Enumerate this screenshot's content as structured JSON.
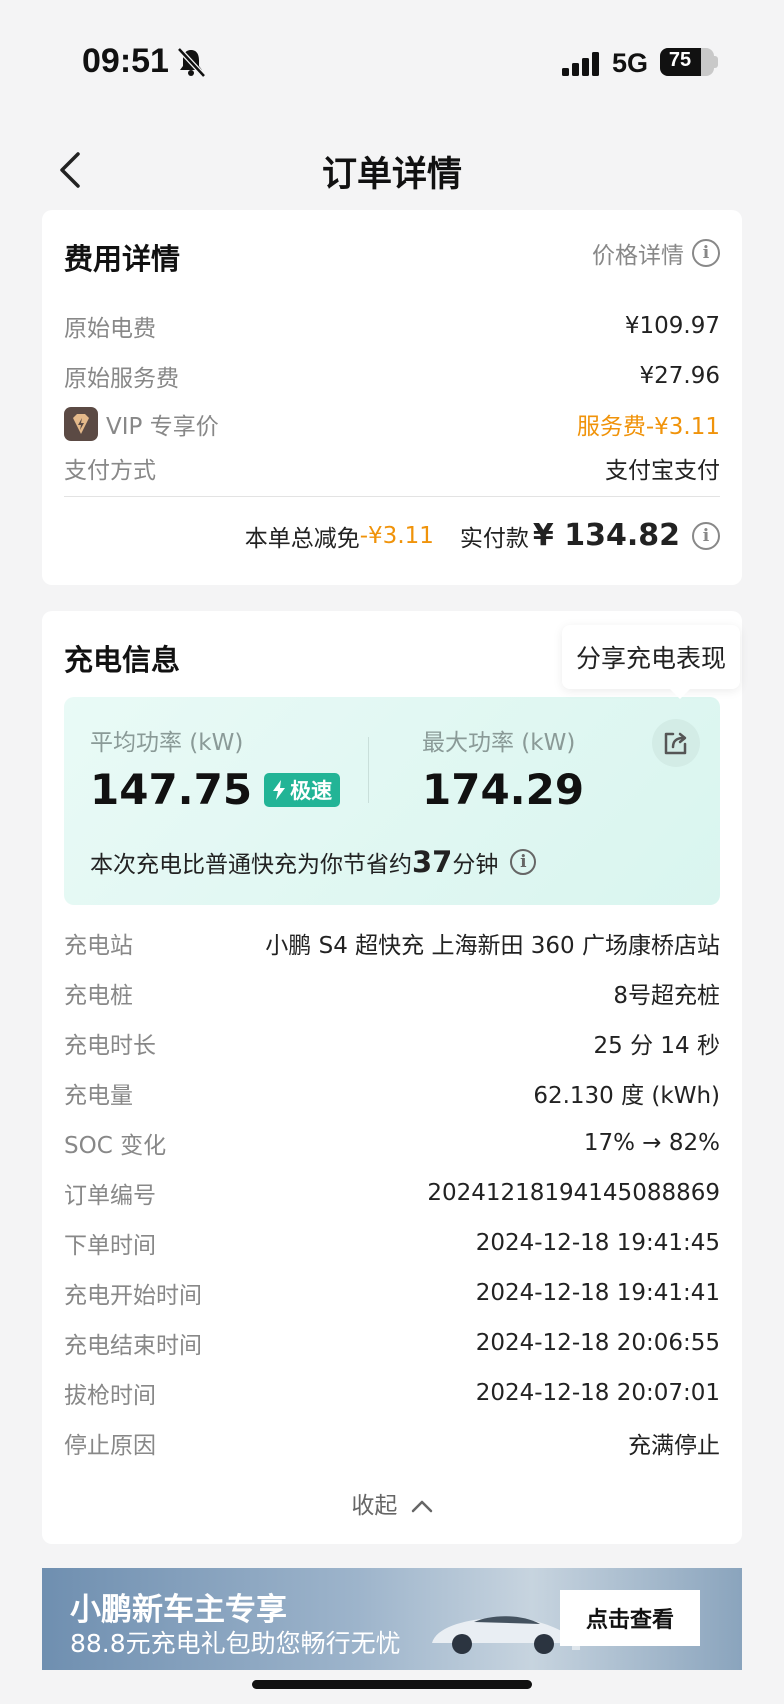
{
  "status_bar": {
    "time": "09:51",
    "network": "5G",
    "battery": "75"
  },
  "nav": {
    "title": "订单详情"
  },
  "fee": {
    "title": "费用详情",
    "price_link": "价格详情",
    "rows": [
      {
        "label": "原始电费",
        "value": "¥109.97"
      },
      {
        "label": "原始服务费",
        "value": "¥27.96"
      },
      {
        "label": "VIP 专享价",
        "value": "服务费-¥3.11"
      },
      {
        "label": "支付方式",
        "value": "支付宝支付"
      }
    ],
    "total_discount_label": "本单总减免",
    "total_discount_value": "-¥3.11",
    "paid_label": "实付款",
    "paid_value": "¥ 134.82"
  },
  "charge": {
    "title": "充电信息",
    "tooltip": "分享充电表现",
    "avg_power_label": "平均功率 (kW)",
    "avg_power_value": "147.75",
    "fast_tag": "极速",
    "max_power_label": "最大功率 (kW)",
    "max_power_value": "174.29",
    "save_prefix": "本次充电比普通快充为你节省约",
    "save_minutes": "37",
    "save_suffix": "分钟",
    "rows": [
      {
        "label": "充电站",
        "value": "小鹏 S4 超快充 上海新田 360 广场康桥店站"
      },
      {
        "label": "充电桩",
        "value": "8号超充桩"
      },
      {
        "label": "充电时长",
        "value": "25 分 14 秒"
      },
      {
        "label": "充电量",
        "value": "62.130 度 (kWh)"
      },
      {
        "label": "SOC 变化",
        "value": "17% → 82%"
      },
      {
        "label": "订单编号",
        "value": "20241218194145088869"
      },
      {
        "label": "下单时间",
        "value": "2024-12-18 19:41:45"
      },
      {
        "label": "充电开始时间",
        "value": "2024-12-18 19:41:41"
      },
      {
        "label": "充电结束时间",
        "value": "2024-12-18 20:06:55"
      },
      {
        "label": "拔枪时间",
        "value": "2024-12-18 20:07:01"
      },
      {
        "label": "停止原因",
        "value": "充满停止"
      }
    ],
    "collapse_label": "收起"
  },
  "banner": {
    "title": "小鹏新车主专享",
    "subtitle": "88.8元充电礼包助您畅行无忧",
    "button": "点击查看"
  },
  "colors": {
    "accent_orange": "#f0930a",
    "fast_green": "#22b496"
  }
}
